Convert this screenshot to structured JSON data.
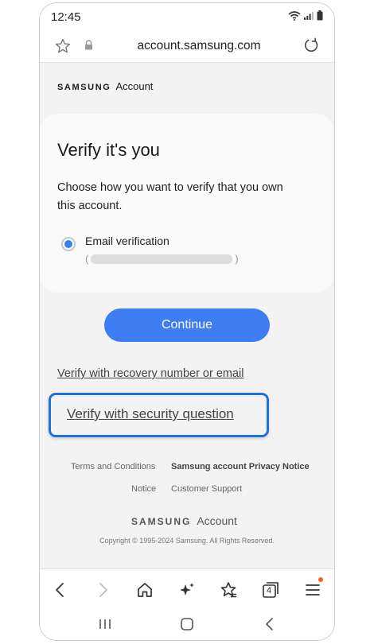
{
  "status_bar": {
    "time": "12:45"
  },
  "browser": {
    "url": "account.samsung.com",
    "tab_count": "4"
  },
  "header": {
    "brand_word": "SAMSUNG",
    "brand_suffix": "Account"
  },
  "card": {
    "title": "Verify it's you",
    "description": "Choose how you want to verify that you own this account.",
    "option_label": "Email verification",
    "option_email_open": "(",
    "option_email_close": ")"
  },
  "actions": {
    "continue_label": "Continue",
    "recovery_link": "Verify with recovery number or email",
    "security_link": "Verify with security question"
  },
  "footer": {
    "links": [
      "Terms and Conditions",
      "Samsung account Privacy Notice",
      "Notice",
      "Customer Support"
    ],
    "brand_word": "SAMSUNG",
    "brand_suffix": "Account",
    "copyright": "Copyright © 1995-2024 Samsung. All Rights Reserved."
  },
  "colors": {
    "accent": "#3d7cf1",
    "highlight_border": "#1f6fe0",
    "badge": "#f0642c"
  }
}
